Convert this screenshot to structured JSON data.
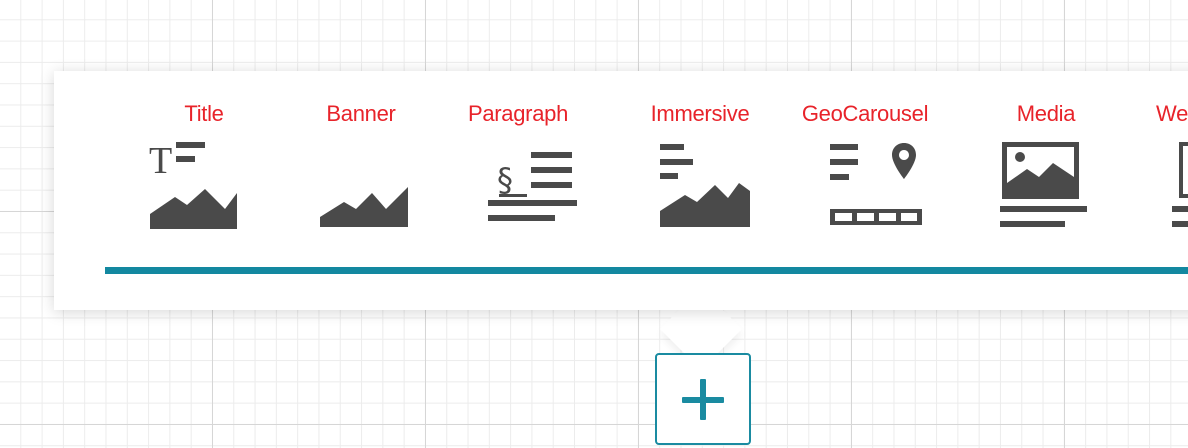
{
  "toolbar": {
    "items": [
      {
        "label": "Title",
        "icon": "title-image-icon"
      },
      {
        "label": "Banner",
        "icon": "banner-image-icon"
      },
      {
        "label": "Paragraph",
        "icon": "paragraph-icon"
      },
      {
        "label": "Immersive",
        "icon": "immersive-icon"
      },
      {
        "label": "GeoCarousel",
        "icon": "geocarousel-icon"
      },
      {
        "label": "Media",
        "icon": "media-icon"
      },
      {
        "label": "Web",
        "icon": "web-embed-icon"
      }
    ]
  },
  "add_button": {
    "icon": "plus-icon"
  },
  "colors": {
    "label": "#e8232a",
    "icon": "#4a4a4a",
    "accent": "#1388a0"
  }
}
